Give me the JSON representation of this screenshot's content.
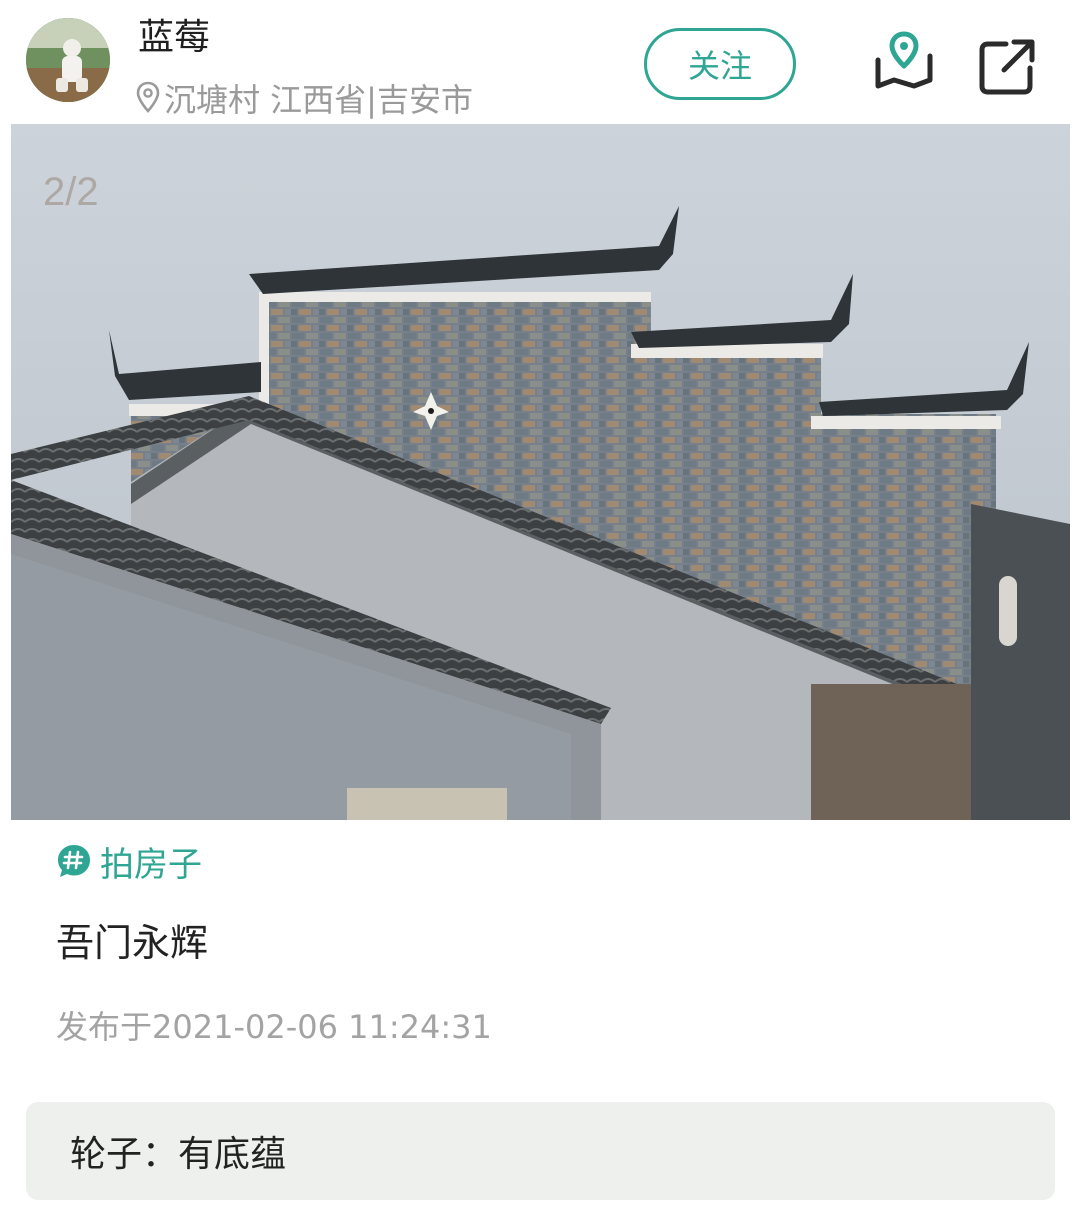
{
  "header": {
    "username": "蓝莓",
    "location_text": "沉塘村 江西省|吉安市",
    "follow_label": "关注",
    "icons": {
      "location": "map-pin-icon",
      "map": "map-pin-fold-icon",
      "share": "share-icon"
    }
  },
  "photo": {
    "counter": "2/2"
  },
  "topic": {
    "icon": "hashtag-icon",
    "label": "拍房子"
  },
  "post": {
    "title": "吾门永辉",
    "published": "发布于2021-02-06 11:24:31"
  },
  "comment": {
    "text": "轮子：有底蕴"
  },
  "colors": {
    "accent": "#2fa693",
    "muted_text": "#a3a3a3",
    "comment_bg": "#eef0ee"
  }
}
